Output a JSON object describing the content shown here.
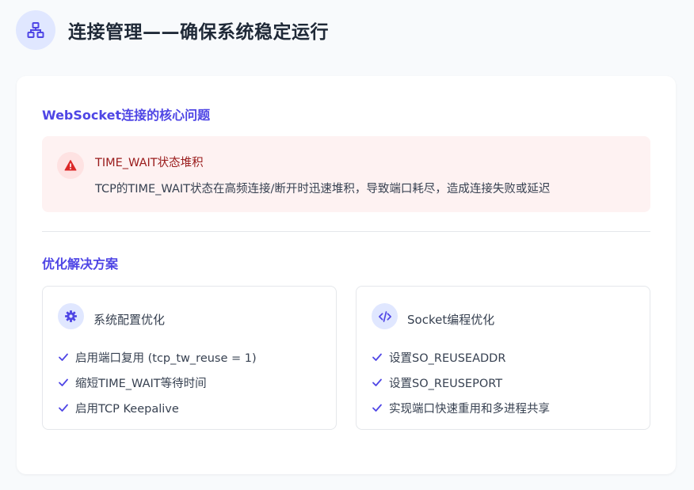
{
  "header": {
    "title": "连接管理——确保系统稳定运行",
    "icon": "network-icon"
  },
  "problem": {
    "section_title": "WebSocket连接的核心问题",
    "alert": {
      "icon": "warning-icon",
      "title": "TIME_WAIT状态堆积",
      "description": "TCP的TIME_WAIT状态在高频连接/断开时迅速堆积，导致端口耗尽，造成连接失败或延迟"
    }
  },
  "solutions": {
    "section_title": "优化解决方案",
    "cards": [
      {
        "icon": "gear-icon",
        "title": "系统配置优化",
        "items": [
          "启用端口复用 (tcp_tw_reuse = 1)",
          "缩短TIME_WAIT等待时间",
          "启用TCP Keepalive"
        ]
      },
      {
        "icon": "code-icon",
        "title": "Socket编程优化",
        "items": [
          "设置SO_REUSEADDR",
          "设置SO_REUSEPORT",
          "实现端口快速重用和多进程共享"
        ]
      }
    ]
  },
  "colors": {
    "accent": "#4f46e5",
    "danger": "#991b1b",
    "alert_bg": "#fef2f2",
    "icon_bg": "#e0e7ff"
  }
}
